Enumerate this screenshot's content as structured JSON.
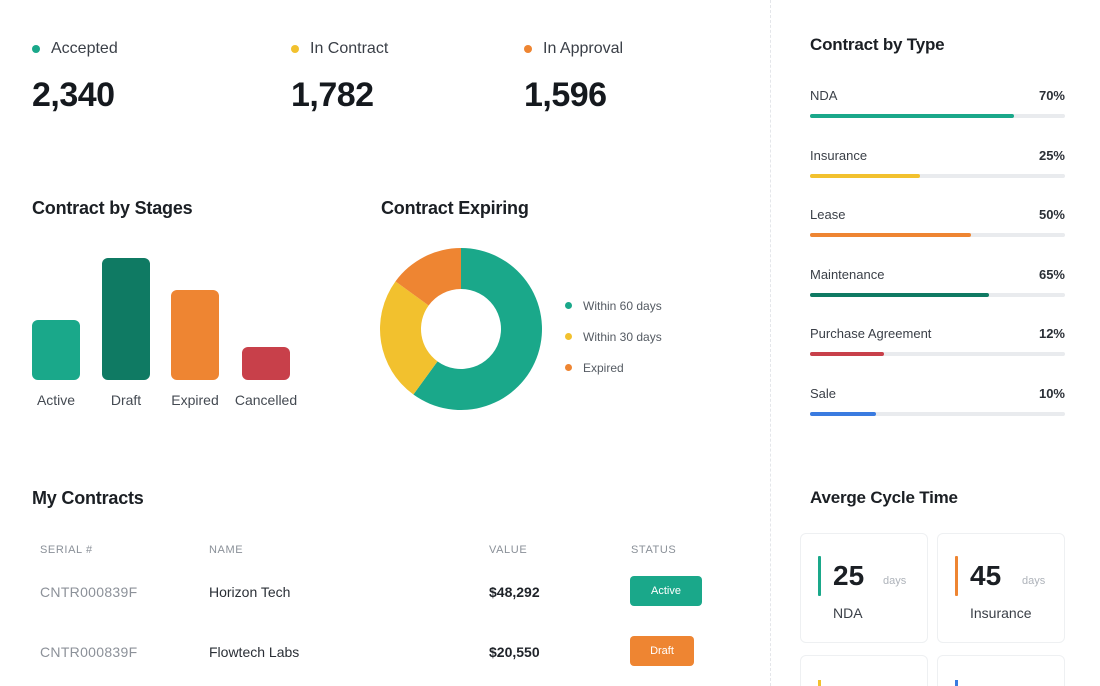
{
  "stats": [
    {
      "label": "Accepted",
      "value": "2,340",
      "color": "#1aa88a"
    },
    {
      "label": "In Contract",
      "value": "1,782",
      "color": "#f2c12e"
    },
    {
      "label": "In Approval",
      "value": "1,596",
      "color": "#ee8532"
    }
  ],
  "stages": {
    "title": "Contract by Stages",
    "chart_data": {
      "type": "bar",
      "categories": [
        "Active",
        "Draft",
        "Expired",
        "Cancelled"
      ],
      "values": [
        60,
        122,
        90,
        33
      ],
      "colors": [
        "#1aa88a",
        "#0f7a63",
        "#ee8532",
        "#c8404a"
      ]
    }
  },
  "expiring": {
    "title": "Contract Expiring",
    "chart_data": {
      "type": "pie",
      "donut": true,
      "labels": [
        "Within 60 days",
        "Within 30 days",
        "Expired"
      ],
      "values": [
        60,
        25,
        15
      ],
      "colors": [
        "#1aa88a",
        "#f2c12e",
        "#ee8532"
      ]
    }
  },
  "contracts": {
    "title": "My Contracts",
    "headers": [
      "SERIAL #",
      "NAME",
      "VALUE",
      "STATUS"
    ],
    "rows": [
      {
        "serial": "CNTR000839F",
        "name": "Horizon Tech",
        "value": "$48,292",
        "status": "Active",
        "status_color": "#1aa88a"
      },
      {
        "serial": "CNTR000839F",
        "name": "Flowtech Labs",
        "value": "$20,550",
        "status": "Draft",
        "status_color": "#ee8532"
      }
    ]
  },
  "by_type": {
    "title": "Contract  by Type",
    "items": [
      {
        "label": "NDA",
        "percent": "70%",
        "value": 0.8,
        "color": "#1aa88a"
      },
      {
        "label": "Insurance",
        "percent": "25%",
        "value": 0.43,
        "color": "#f2c12e"
      },
      {
        "label": "Lease",
        "percent": "50%",
        "value": 0.63,
        "color": "#ee8532"
      },
      {
        "label": "Maintenance",
        "percent": "65%",
        "value": 0.7,
        "color": "#0f7a63"
      },
      {
        "label": "Purchase Agreement",
        "percent": "12%",
        "value": 0.29,
        "color": "#c8404a"
      },
      {
        "label": "Sale",
        "percent": "10%",
        "value": 0.26,
        "color": "#3a7be0"
      }
    ]
  },
  "cycle": {
    "title": "Averge Cycle Time",
    "cards": [
      {
        "value": "25",
        "unit": "days",
        "label": "NDA",
        "color": "#1aa88a"
      },
      {
        "value": "45",
        "unit": "days",
        "label": "Insurance",
        "color": "#ee8532"
      }
    ],
    "stub_colors": [
      "#f2c12e",
      "#3a7be0"
    ]
  }
}
